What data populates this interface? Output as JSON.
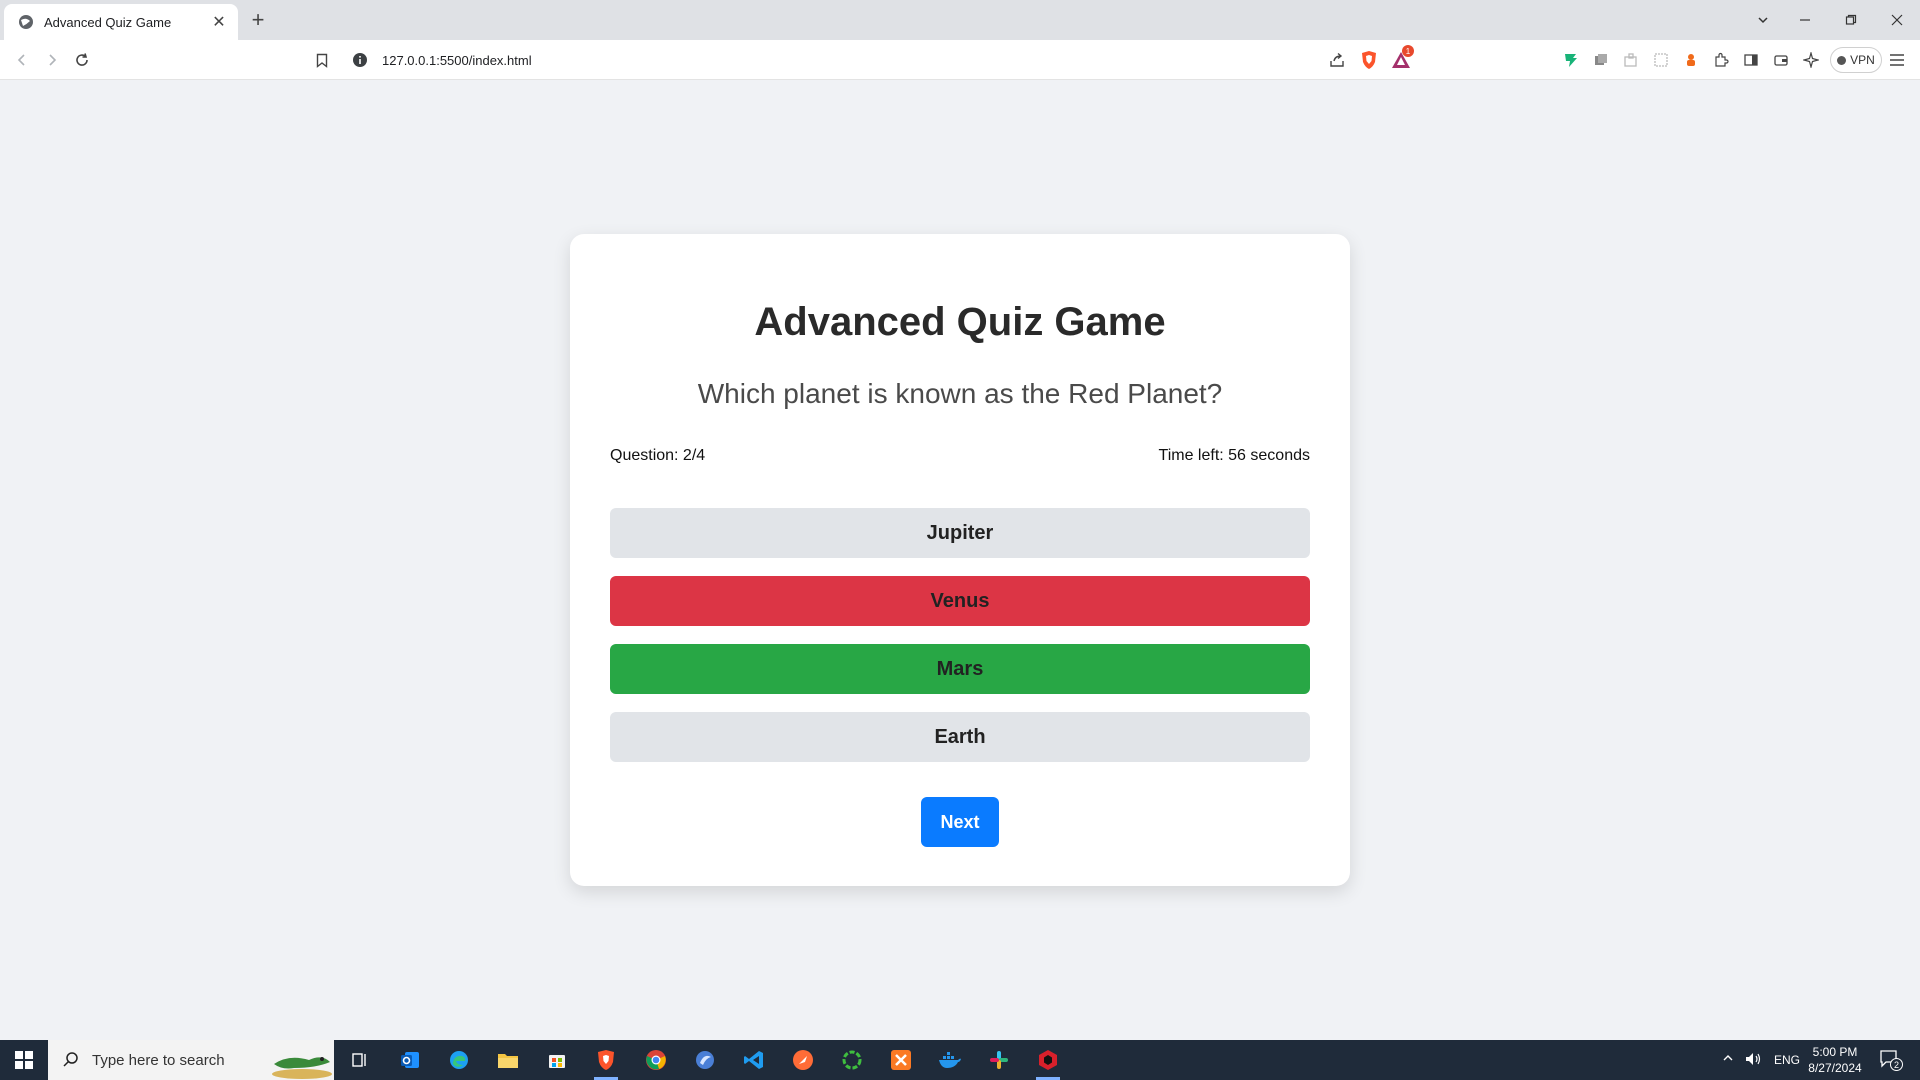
{
  "browser": {
    "tab_title": "Advanced Quiz Game",
    "url": "127.0.0.1:5500/index.html",
    "shield_badge": "1",
    "vpn_label": "VPN"
  },
  "quiz": {
    "title": "Advanced Quiz Game",
    "question": "Which planet is known as the Red Planet?",
    "question_counter": "Question: 2/4",
    "timer": "Time left: 56 seconds",
    "options": [
      {
        "label": "Jupiter",
        "state": "neutral",
        "color": "#e1e4e8"
      },
      {
        "label": "Venus",
        "state": "incorrect",
        "color": "#dc3545"
      },
      {
        "label": "Mars",
        "state": "correct",
        "color": "#28a745"
      },
      {
        "label": "Earth",
        "state": "neutral",
        "color": "#e1e4e8"
      }
    ],
    "next_label": "Next",
    "accent_color": "#0a7bff"
  },
  "taskbar": {
    "search_placeholder": "Type here to search",
    "language": "ENG",
    "time": "5:00 PM",
    "date": "8/27/2024",
    "notification_count": "2",
    "apps": [
      "task-view",
      "outlook",
      "edge",
      "file-explorer",
      "store",
      "brave",
      "chrome",
      "app-blue",
      "vscode",
      "postman",
      "app-green",
      "xampp",
      "docker",
      "slack",
      "app-red"
    ]
  }
}
